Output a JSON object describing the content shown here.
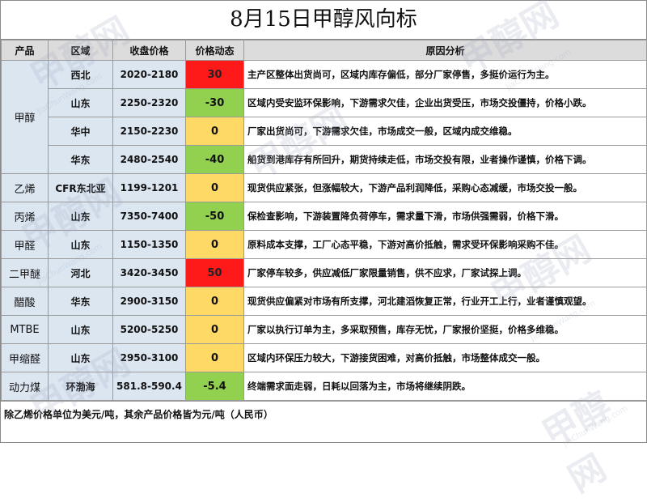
{
  "title": "8月15日甲醇风向标",
  "headers": [
    "产品",
    "区域",
    "收盘价格",
    "价格动态",
    "原因分析"
  ],
  "rows": [
    {
      "product": "甲醇",
      "region": "西北",
      "price": "2020-2180",
      "change": "30",
      "trend": "up",
      "reason": "主产区整体出货尚可，区域内库存偏低，部分厂家停售，多挺价运行为主。"
    },
    {
      "product": "",
      "region": "山东",
      "price": "2250-2320",
      "change": "-30",
      "trend": "down",
      "reason": "区域内受安监环保影响，下游需求欠佳，企业出货受压，市场交投僵持，价格小跌。"
    },
    {
      "product": "",
      "region": "华中",
      "price": "2150-2230",
      "change": "0",
      "trend": "flat",
      "reason": "厂家出货尚可，下游需求欠佳，市场成交一般，区域内成交维稳。"
    },
    {
      "product": "",
      "region": "华东",
      "price": "2480-2540",
      "change": "-40",
      "trend": "down",
      "reason": "船货到港库存有所回升，期货持续走低，市场交投有限，业者操作谨慎，价格下调。"
    },
    {
      "product": "乙烯",
      "region": "CFR东北亚",
      "price": "1199-1201",
      "change": "0",
      "trend": "flat",
      "reason": "现货供应紧张，但涨幅较大，下游产品利润降低，采购心态减缓，市场交投一般。"
    },
    {
      "product": "丙烯",
      "region": "山东",
      "price": "7350-7400",
      "change": "-50",
      "trend": "down",
      "reason": "保检查影响，下游装置降负荷停车，需求量下滑，市场供强需弱，价格下滑。"
    },
    {
      "product": "甲醛",
      "region": "山东",
      "price": "1150-1350",
      "change": "0",
      "trend": "flat",
      "reason": "原料成本支撑，工厂心态平稳，下游对高价抵触，需求受环保影响采购不佳。"
    },
    {
      "product": "二甲醚",
      "region": "河北",
      "price": "3420-3450",
      "change": "50",
      "trend": "up",
      "reason": "厂家停车较多，供应减低厂家限量销售，供不应求，厂家试探上调。"
    },
    {
      "product": "醋酸",
      "region": "华东",
      "price": "2900-3150",
      "change": "0",
      "trend": "flat",
      "reason": "现货供应偏紧对市场有所支撑，河北建滔恢复正常，行业开工上行，业者谨慎观望。"
    },
    {
      "product": "MTBE",
      "region": "山东",
      "price": "5200-5250",
      "change": "0",
      "trend": "flat",
      "reason": "厂家以执行订单为主，多采取预售，库存无忧，厂家报价坚挺，价格多维稳。"
    },
    {
      "product": "甲缩醛",
      "region": "山东",
      "price": "2950-3100",
      "change": "0",
      "trend": "flat",
      "reason": "区域内环保压力较大，下游接货困难，对高价抵触，市场整体成交一般。"
    },
    {
      "product": "动力煤",
      "region": "环渤海",
      "price": "581.8-590.4",
      "change": "-5.4",
      "trend": "down",
      "reason": "终端需求面走弱，日耗以回落为主，市场将继续阴跌。"
    }
  ],
  "footer": "除乙烯价格单位为美元/吨，其余产品价格皆为元/吨（人民币）",
  "watermark": "甲醇网",
  "watermark_url": "JiaChunWang.com",
  "colors": {
    "up": "#ff1a1a",
    "down": "#92d050",
    "flat": "#ffd966",
    "header_bg": "#dcdcdc",
    "cell_bg": "#dce6f1"
  }
}
